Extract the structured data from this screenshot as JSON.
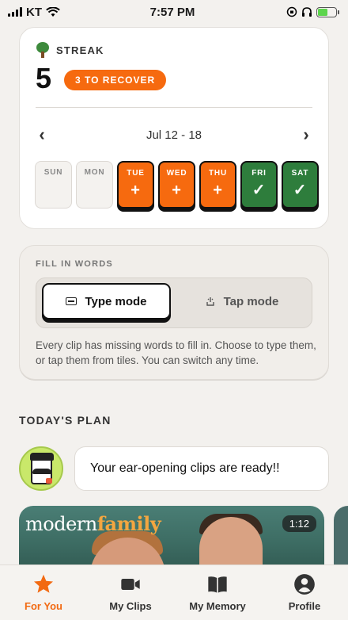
{
  "status_bar": {
    "carrier": "KT",
    "time": "7:57 PM"
  },
  "streak": {
    "header": "STREAK",
    "count": "5",
    "recover_label": "3 TO RECOVER",
    "week_label": "Jul 12 - 18",
    "prev_icon": "‹",
    "next_icon": "›",
    "days": [
      {
        "label": "SUN",
        "state": "empty",
        "mark": ""
      },
      {
        "label": "MON",
        "state": "empty",
        "mark": ""
      },
      {
        "label": "TUE",
        "state": "recover",
        "mark": "+"
      },
      {
        "label": "WED",
        "state": "recover",
        "mark": "+"
      },
      {
        "label": "THU",
        "state": "recover",
        "mark": "+"
      },
      {
        "label": "FRI",
        "state": "done",
        "mark": "✓"
      },
      {
        "label": "SAT",
        "state": "done",
        "mark": "✓"
      }
    ]
  },
  "fill_in_words": {
    "title": "FILL IN WORDS",
    "type_mode_label": "Type mode",
    "tap_mode_label": "Tap mode",
    "selected_mode": "Type mode",
    "description": "Every clip has missing words to fill in. Choose to type them, or tap them from tiles. You can switch any time."
  },
  "todays_plan": {
    "title": "TODAY'S PLAN",
    "message": "Your ear-opening clips are ready!!",
    "clip": {
      "logo_part1": "modern",
      "logo_part2": "family",
      "duration": "1:12"
    }
  },
  "tabs": [
    {
      "label": "For You",
      "icon": "star-icon",
      "active": true
    },
    {
      "label": "My Clips",
      "icon": "video-camera-icon",
      "active": false
    },
    {
      "label": "My Memory",
      "icon": "book-icon",
      "active": false
    },
    {
      "label": "Profile",
      "icon": "person-icon",
      "active": false
    }
  ],
  "colors": {
    "accent": "#f66a0f",
    "success": "#2e7d3c",
    "background": "#f3f1ee"
  }
}
